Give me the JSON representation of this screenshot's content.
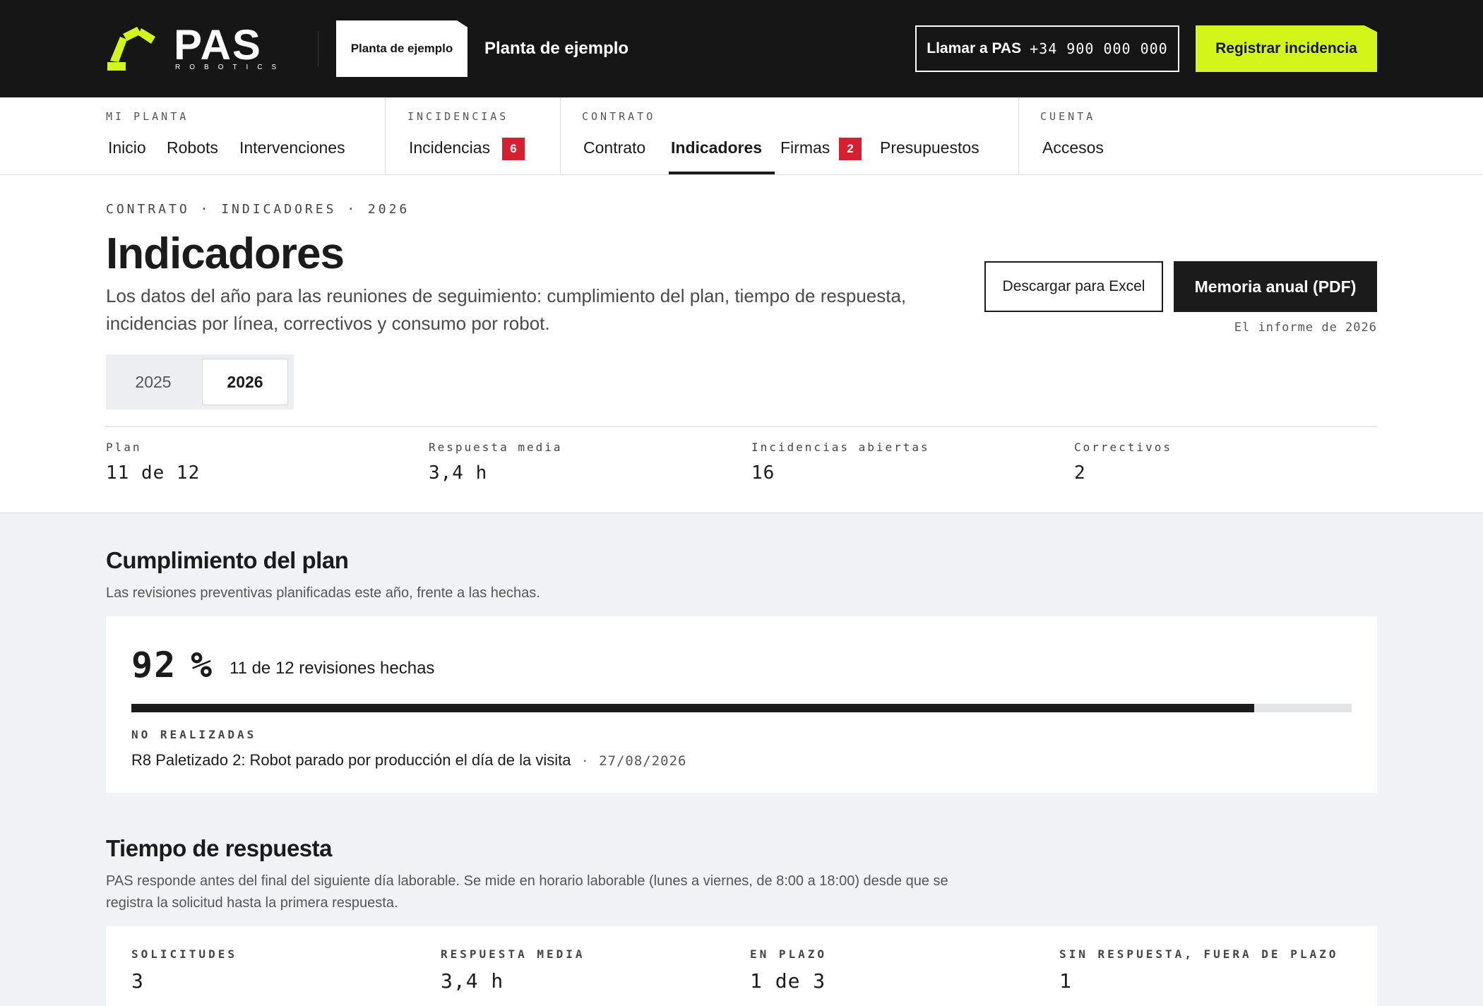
{
  "header": {
    "logo_text": "PAS",
    "logo_sub": "ROBOTICS",
    "plant_chip": "Planta de ejemplo",
    "plant_name": "Planta de ejemplo",
    "call_label": "Llamar a PAS",
    "call_phone": "+34 900 000 000",
    "report_button": "Registrar incidencia",
    "accent_color": "#d4f51a"
  },
  "nav": {
    "groups": [
      {
        "label": "MI PLANTA",
        "items": [
          "Inicio",
          "Robots",
          "Intervenciones"
        ]
      },
      {
        "label": "INCIDENCIAS",
        "items": [
          "Incidencias"
        ],
        "badges": [
          "6"
        ]
      },
      {
        "label": "CONTRATO",
        "items": [
          "Contrato",
          "Indicadores",
          "Firmas",
          "Presupuestos"
        ],
        "badges": [
          "2"
        ]
      },
      {
        "label": "CUENTA",
        "items": [
          "Accesos"
        ]
      }
    ],
    "active": "Indicadores"
  },
  "page": {
    "breadcrumb": "CONTRATO · INDICADORES · 2026",
    "title": "Indicadores",
    "description": "Los datos del año para las reuniones de seguimiento: cumplimiento del plan, tiempo de respuesta, incidencias por línea, correctivos y consumo por robot.",
    "excel_button": "Descargar para Excel",
    "pdf_button": "Memoria anual (PDF)",
    "pdf_note": "El informe de 2026",
    "years": [
      "2025",
      "2026"
    ],
    "selected_year": "2026"
  },
  "kpis": [
    {
      "label": "Plan",
      "value": "11 de 12"
    },
    {
      "label": "Respuesta media",
      "value": "3,4 h"
    },
    {
      "label": "Incidencias abiertas",
      "value": "16"
    },
    {
      "label": "Correctivos",
      "value": "2"
    }
  ],
  "plan": {
    "title": "Cumplimiento del plan",
    "description": "Las revisiones preventivas planificadas este año, frente a las hechas.",
    "percent": "92",
    "percent_sign": "%",
    "caption": "11 de 12 revisiones hechas",
    "progress": 0.92,
    "missed_label": "NO REALIZADAS",
    "missed_items": [
      {
        "text": "R8 Paletizado 2: Robot parado por producción el día de la visita",
        "sep": "·",
        "date": "27/08/2026"
      }
    ]
  },
  "response": {
    "title": "Tiempo de respuesta",
    "description": "PAS responde antes del final del siguiente día laborable. Se mide en horario laborable (lunes a viernes, de 8:00 a 18:00) desde que se registra la solicitud hasta la primera respuesta.",
    "kpis": [
      {
        "label": "SOLICITUDES",
        "value": "3"
      },
      {
        "label": "RESPUESTA MEDIA",
        "value": "3,4 h"
      },
      {
        "label": "EN PLAZO",
        "value": "1 de 3"
      },
      {
        "label": "SIN RESPUESTA, FUERA DE PLAZO",
        "value": "1"
      }
    ]
  }
}
